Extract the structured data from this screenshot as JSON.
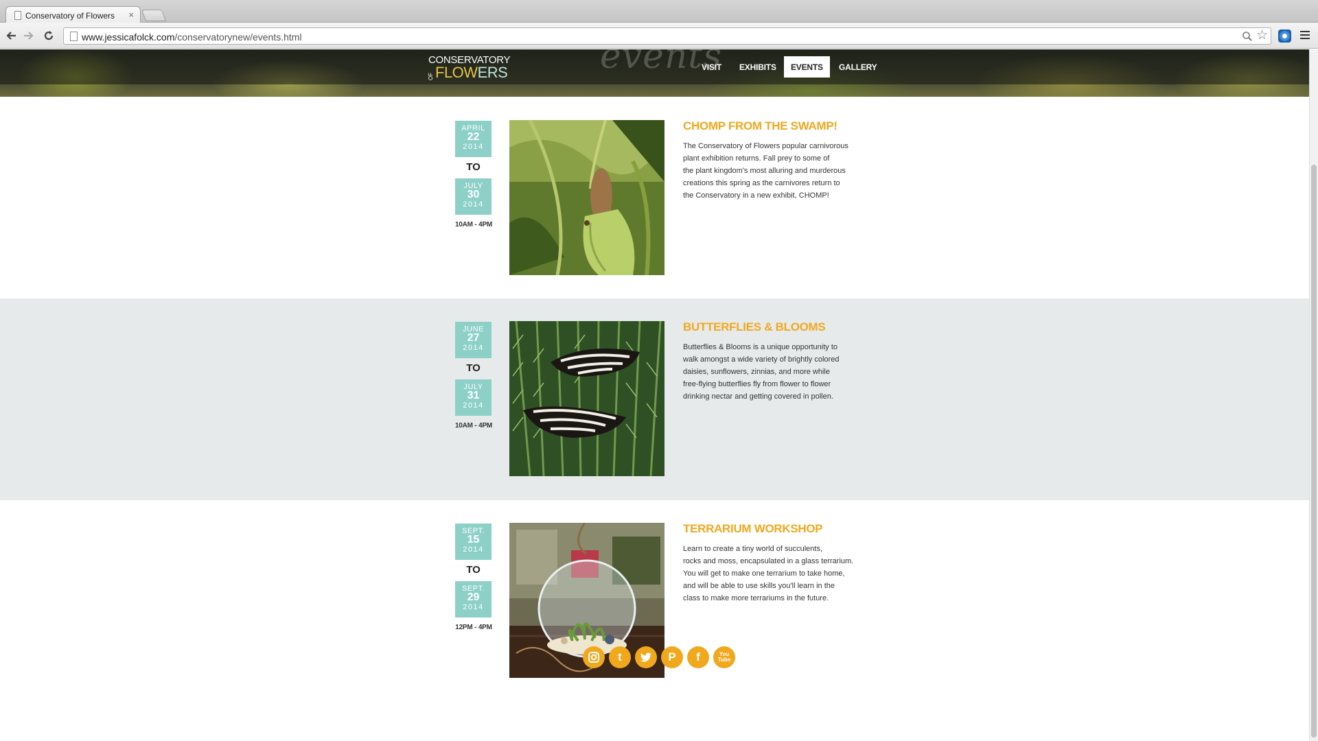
{
  "browser": {
    "tab_title": "Conservatory of Flowers",
    "url_domain": "www.jessicafolck.com",
    "url_path": "/conservatorynew/events.html"
  },
  "header": {
    "logo_line1": "CONSERVATORY",
    "logo_of": "OF",
    "logo_flow": "FLOW",
    "logo_ers": "ERS",
    "script_word": "events",
    "nav": [
      "VISIT",
      "EXHIBITS",
      "EVENTS",
      "GALLERY"
    ],
    "active_nav": "EVENTS"
  },
  "events": [
    {
      "start": {
        "month": "APRIL",
        "day": "22",
        "year": "2014"
      },
      "to": "TO",
      "end": {
        "month": "JULY",
        "day": "30",
        "year": "2014"
      },
      "hours": "10AM - 4PM",
      "title": "CHOMP FROM THE SWAMP!",
      "desc": [
        "The Conservatory of Flowers popular carnivorous",
        "plant exhibition returns. Fall prey to some of",
        "the plant kingdom's most alluring and murderous",
        "creations this spring as the carnivores return to",
        "the Conservatory in a new exhibit, CHOMP!"
      ]
    },
    {
      "start": {
        "month": "JUNE",
        "day": "27",
        "year": "2014"
      },
      "to": "TO",
      "end": {
        "month": "JULY",
        "day": "31",
        "year": "2014"
      },
      "hours": "10AM - 4PM",
      "title": "BUTTERFLIES & BLOOMS",
      "desc": [
        "Butterflies & Blooms is a unique opportunity to",
        "walk amongst a wide variety of brightly colored",
        "daisies, sunflowers, zinnias, and more while",
        "free-flying butterflies fly from flower to flower",
        "drinking nectar and getting covered in pollen."
      ]
    },
    {
      "start": {
        "month": "SEPT.",
        "day": "15",
        "year": "2014"
      },
      "to": "TO",
      "end": {
        "month": "SEPT.",
        "day": "29",
        "year": "2014"
      },
      "hours": "12PM - 4PM",
      "title": "TERRARIUM WORKSHOP",
      "desc": [
        "Learn to create a tiny world of succulents,",
        "rocks and moss, encapsulated in a glass terrarium.",
        "You will get to make one terrarium to take home,",
        "and will be able to use skills you'll learn in the",
        "class to make more terrariums in the future."
      ]
    }
  ],
  "social": {
    "icons": [
      "instagram-icon",
      "tumblr-icon",
      "twitter-icon",
      "pinterest-icon",
      "facebook-icon",
      "youtube-icon"
    ],
    "tumblr_glyph": "t",
    "pinterest_glyph": "P",
    "facebook_glyph": "f",
    "youtube_glyph": "You Tube"
  },
  "colors": {
    "accent_orange": "#f2a81d",
    "date_teal": "#8dd0c8",
    "band_gray": "#e6eaea"
  }
}
